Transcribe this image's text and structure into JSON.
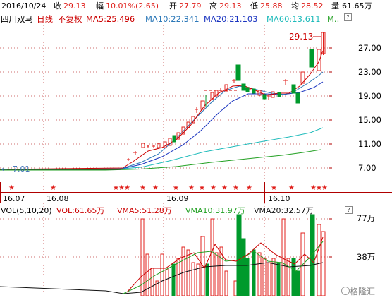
{
  "quote_bar": {
    "date": "2016/10/24",
    "close_label": "收",
    "close": "29.13",
    "change_label": "幅",
    "change": "10.01%(2.65)",
    "open_label": "开",
    "open": "27.79",
    "high_label": "高",
    "high": "29.13",
    "low_label": "低",
    "low": "25.88",
    "avg_label": "均",
    "avg": "28.52",
    "volume_label": "量",
    "volume": "61.65万"
  },
  "chart_header": {
    "stock_name": "四川双马",
    "period": "日线",
    "adjust": "不复权",
    "ma5": "MA5:25.496",
    "ma10": "MA10:22.341",
    "ma20": "MA20:21.103",
    "ma60": "MA60:13.611",
    "more": "M..",
    "help": "?"
  },
  "price_axis": [
    "27.00",
    "23.00",
    "19.00",
    "15.00",
    "11.00",
    "7.00"
  ],
  "price_high_marker": "29.13",
  "price_low_marker": "7.01",
  "date_axis": [
    "16.07",
    "16.08",
    "16.09",
    "16.10"
  ],
  "volume_header": {
    "indicator": "VOL(5,10,20)",
    "vol": "VOL:61.65万",
    "vma5": "VMA5:51.28万",
    "vma10": "VMA10:31.97万",
    "vma20": "VMA20:32.57万",
    "help": "?"
  },
  "volume_axis": [
    "77万",
    "38万"
  ],
  "watermark": "格隆汇",
  "colors": {
    "up": "#e0201c",
    "down": "#009a2c",
    "ma5": "#cc0000",
    "ma10": "#2c78b8",
    "ma20": "#1a34c0",
    "ma60": "#1fbbbb",
    "ma120": "#22a022",
    "grid": "#b00000",
    "header_blue": "#0000cc"
  }
}
